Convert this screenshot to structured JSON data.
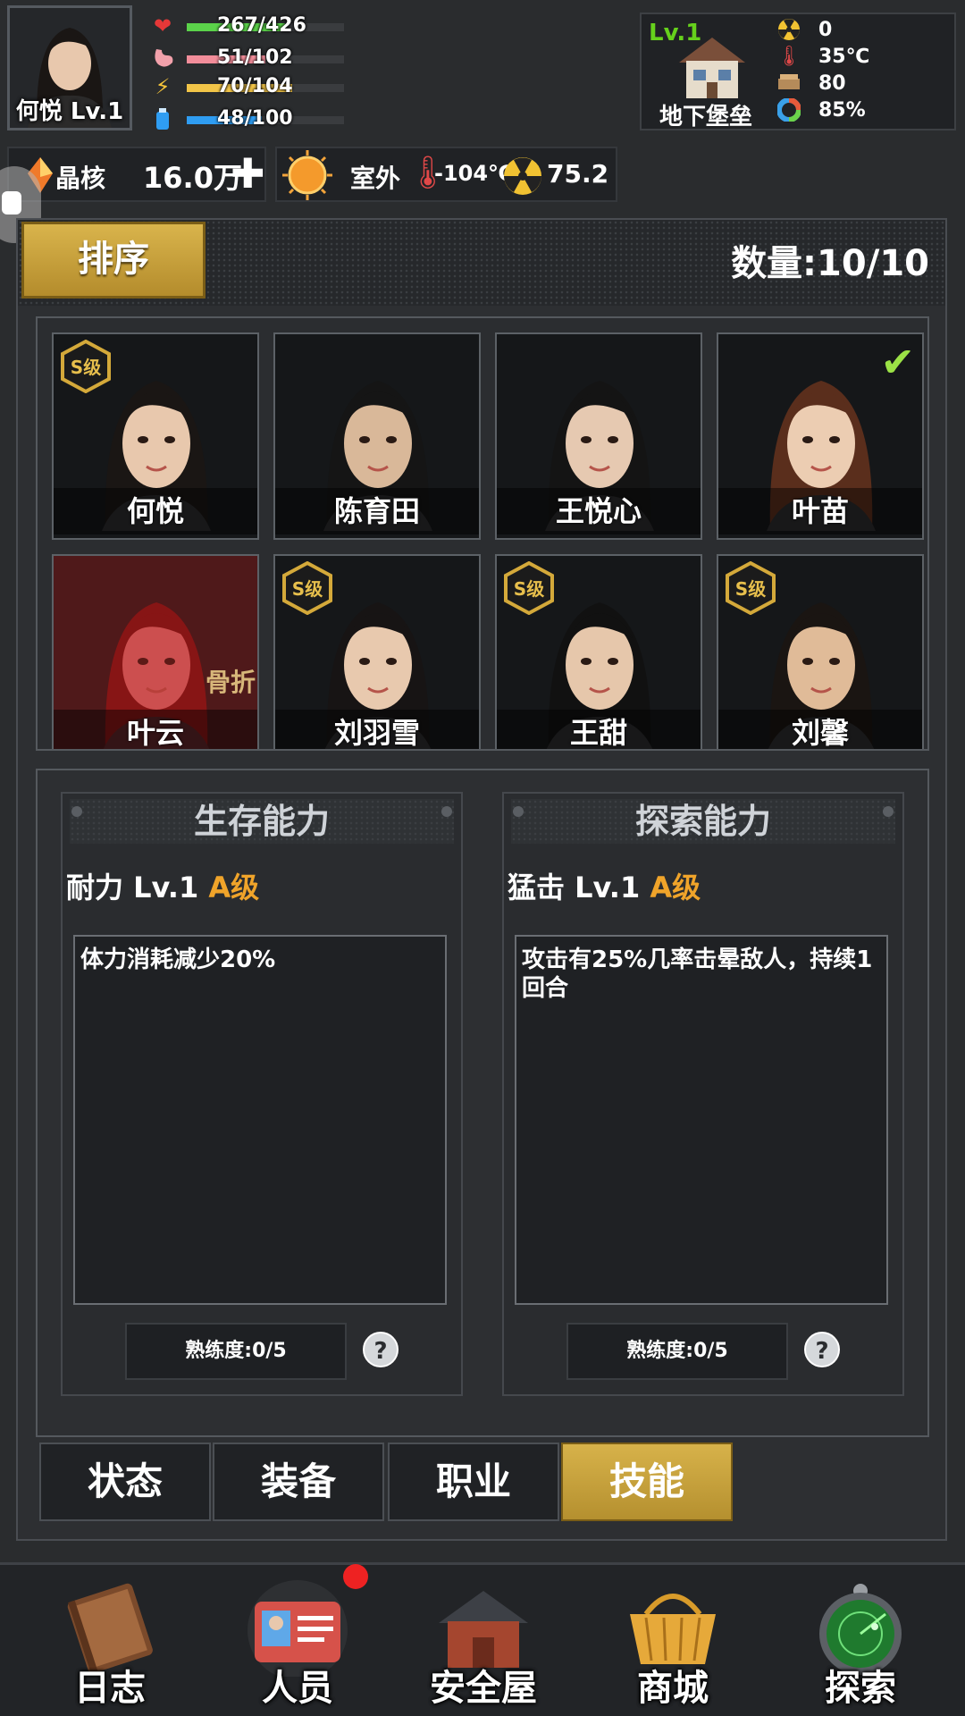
{
  "player": {
    "name_level": "何悦 Lv.1",
    "stats": [
      {
        "icon": "heart-icon",
        "value": "267/426",
        "fraction": 0.627,
        "color": "#5bd34a"
      },
      {
        "icon": "stomach-icon",
        "value": "51/102",
        "fraction": 0.5,
        "color": "#f28d9a"
      },
      {
        "icon": "lightning-icon",
        "value": "70/104",
        "fraction": 0.673,
        "color": "#f2c548"
      },
      {
        "icon": "water-icon",
        "value": "48/100",
        "fraction": 0.48,
        "color": "#2f9df2"
      }
    ]
  },
  "base": {
    "level": "Lv.1",
    "name": "地下堡垒",
    "radiation": "0",
    "temperature": "35℃",
    "supplies": "80",
    "integrity": "85%"
  },
  "resources": {
    "core_label": "晶核",
    "core_value": "16.0万",
    "outdoor_label": "室外",
    "outdoor_temp": "-104℃",
    "outdoor_radiation": "75.2"
  },
  "roster": {
    "sort_label": "排序",
    "count_label": "数量:10/10",
    "members": [
      {
        "name": "何悦",
        "rank": "S级",
        "selected": false,
        "status": "",
        "hair": "#1a1614",
        "skin": "#e8c8ad"
      },
      {
        "name": "陈育田",
        "rank": "",
        "selected": false,
        "status": "",
        "hair": "#151515",
        "skin": "#d9b899"
      },
      {
        "name": "王悦心",
        "rank": "",
        "selected": false,
        "status": "",
        "hair": "#141414",
        "skin": "#e6c9b1"
      },
      {
        "name": "叶苗",
        "rank": "",
        "selected": true,
        "status": "",
        "hair": "#5a2e1c",
        "skin": "#eccdb2"
      },
      {
        "name": "叶云",
        "rank": "",
        "selected": false,
        "status": "骨折",
        "hair": "#6b1111",
        "skin": "#d46a6a"
      },
      {
        "name": "刘羽雪",
        "rank": "S级",
        "selected": false,
        "status": "",
        "hair": "#171414",
        "skin": "#e8c9ae"
      },
      {
        "name": "王甜",
        "rank": "S级",
        "selected": false,
        "status": "",
        "hair": "#111",
        "skin": "#e6c7ab"
      },
      {
        "name": "刘馨",
        "rank": "S级",
        "selected": false,
        "status": "",
        "hair": "#1a1512",
        "skin": "#e0bb98"
      }
    ]
  },
  "skills": [
    {
      "header": "生存能力",
      "skill_name": "耐力 Lv.1",
      "grade": "A级",
      "description": "体力消耗减少20%",
      "proficiency": "熟练度:0/5",
      "help": "?"
    },
    {
      "header": "探索能力",
      "skill_name": "猛击 Lv.1",
      "grade": "A级",
      "description": "攻击有25%几率击晕敌人，持续1回合",
      "proficiency": "熟练度:0/5",
      "help": "?"
    }
  ],
  "tabs": [
    "状态",
    "装备",
    "职业",
    "技能"
  ],
  "active_tab": "技能",
  "bottom_nav": [
    {
      "label": "日志",
      "icon": "journal-book-icon"
    },
    {
      "label": "人员",
      "icon": "id-card-icon"
    },
    {
      "label": "安全屋",
      "icon": "safe-house-icon"
    },
    {
      "label": "商城",
      "icon": "shopping-basket-icon"
    },
    {
      "label": "探索",
      "icon": "radar-icon"
    }
  ]
}
